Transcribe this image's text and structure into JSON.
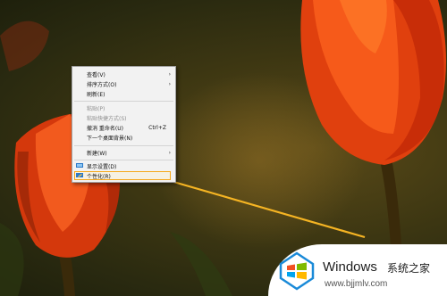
{
  "context_menu": {
    "items": [
      {
        "label": "查看(V)",
        "submenu": true,
        "disabled": false
      },
      {
        "label": "排序方式(O)",
        "submenu": true,
        "disabled": false
      },
      {
        "label": "刷新(E)",
        "submenu": false,
        "disabled": false
      },
      {
        "label": "粘贴(P)",
        "submenu": false,
        "disabled": true
      },
      {
        "label": "粘贴快捷方式(S)",
        "submenu": false,
        "disabled": true
      },
      {
        "label": "撤消 重命名(U)",
        "shortcut": "Ctrl+Z",
        "submenu": false,
        "disabled": false
      },
      {
        "label": "下一个桌面背景(N)",
        "submenu": false,
        "disabled": false
      },
      {
        "label": "新建(W)",
        "submenu": true,
        "disabled": false
      },
      {
        "label": "显示设置(D)",
        "icon": "display-icon",
        "submenu": false,
        "disabled": false
      },
      {
        "label": "个性化(R)",
        "icon": "personalize-icon",
        "submenu": false,
        "disabled": false,
        "highlighted": true
      }
    ]
  },
  "watermark": {
    "brand": "Windows",
    "subtitle": "系统之家",
    "url": "www.bjjmlv.com"
  },
  "colors": {
    "highlight_border": "#f6a81a",
    "arrow": "#f5b423",
    "windows_blue": "#1a8ad8"
  }
}
